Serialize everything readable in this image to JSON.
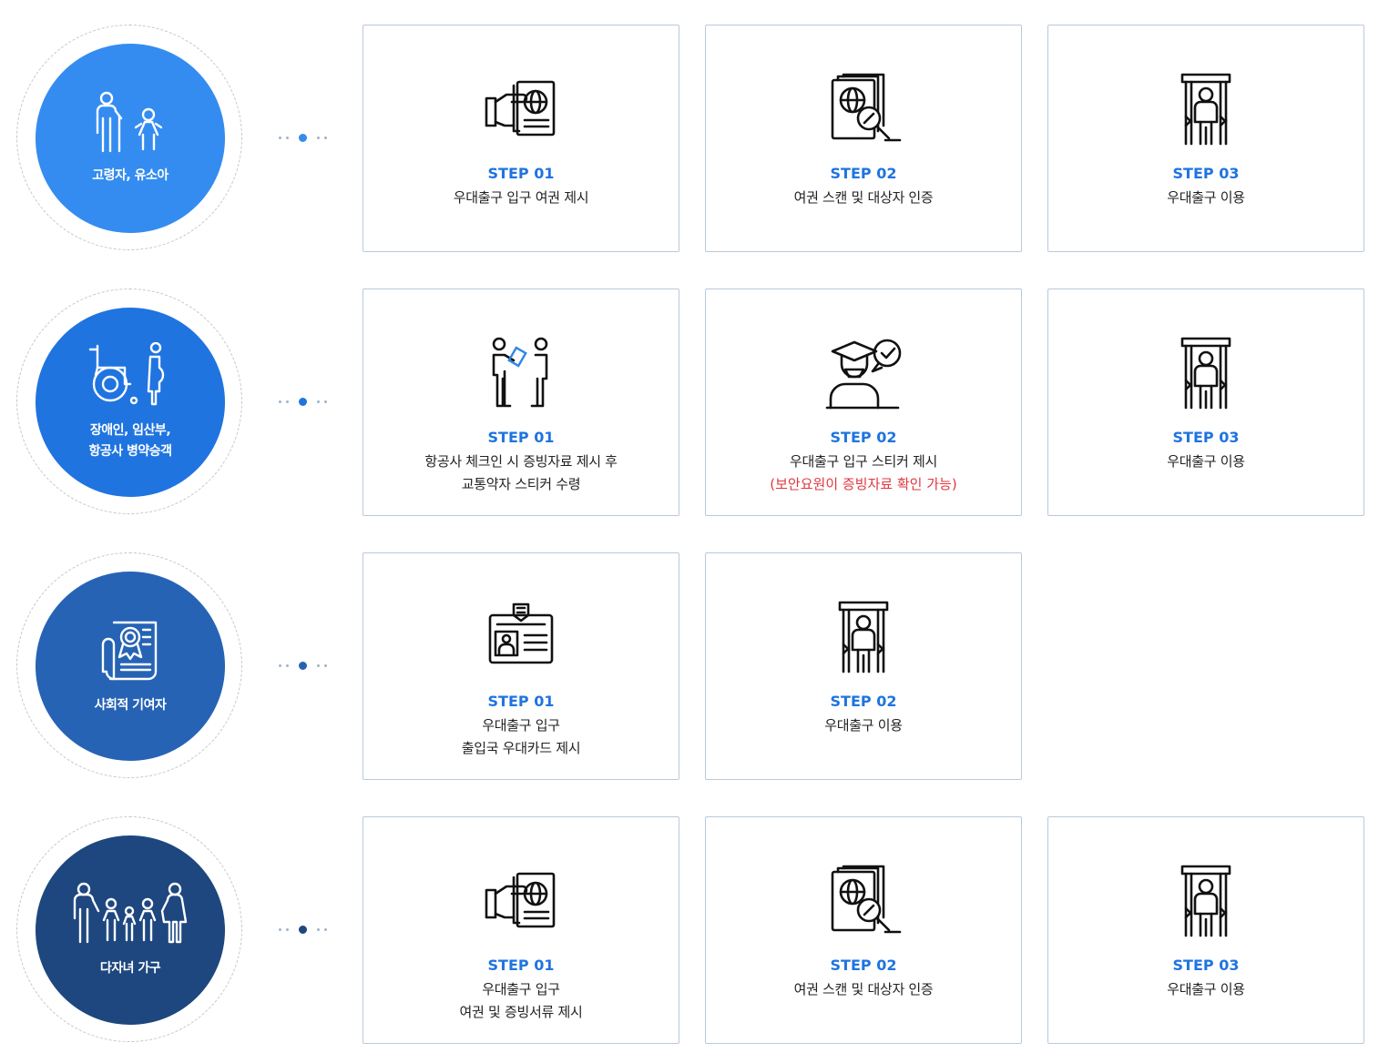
{
  "rows": [
    {
      "category": "고령자, 유소아",
      "icon": "elderly-child-icon",
      "color": "#348cf0",
      "steps": [
        {
          "label": "STEP 01",
          "text": "우대출구 입구 여권 제시",
          "icon": "passport-hand-icon"
        },
        {
          "label": "STEP 02",
          "text": "여권 스캔 및 대상자 인증",
          "icon": "passport-scan-icon"
        },
        {
          "label": "STEP 03",
          "text": "우대출구 이용",
          "icon": "security-gate-icon"
        }
      ]
    },
    {
      "category": "장애인, 임산부,\n항공사 병약승객",
      "icon": "wheelchair-pregnant-icon",
      "color": "#1f74e0",
      "steps": [
        {
          "label": "STEP 01",
          "text": "항공사 체크인 시 증빙자료 제시 후\n교통약자 스티커 수령",
          "icon": "document-handover-icon"
        },
        {
          "label": "STEP 02",
          "text": "우대출구 입구 스티커 제시",
          "note": "(보안요원이 증빙자료 확인 가능)",
          "icon": "security-officer-check-icon"
        },
        {
          "label": "STEP 03",
          "text": "우대출구 이용",
          "icon": "security-gate-icon"
        }
      ]
    },
    {
      "category": "사회적 기여자",
      "icon": "certificate-icon",
      "color": "#2663b5",
      "steps": [
        {
          "label": "STEP 01",
          "text": "우대출구 입구\n출입국 우대카드 제시",
          "icon": "id-card-icon"
        },
        {
          "label": "STEP 02",
          "text": "우대출구 이용",
          "icon": "security-gate-icon"
        }
      ]
    },
    {
      "category": "다자녀 가구",
      "icon": "family-icon",
      "color": "#1d477e",
      "steps": [
        {
          "label": "STEP 01",
          "text": "우대출구 입구\n여권 및 증빙서류 제시",
          "icon": "passport-hand-icon"
        },
        {
          "label": "STEP 02",
          "text": "여권 스캔 및 대상자 인증",
          "icon": "passport-scan-icon"
        },
        {
          "label": "STEP 03",
          "text": "우대출구 이용",
          "icon": "security-gate-icon"
        }
      ]
    }
  ]
}
